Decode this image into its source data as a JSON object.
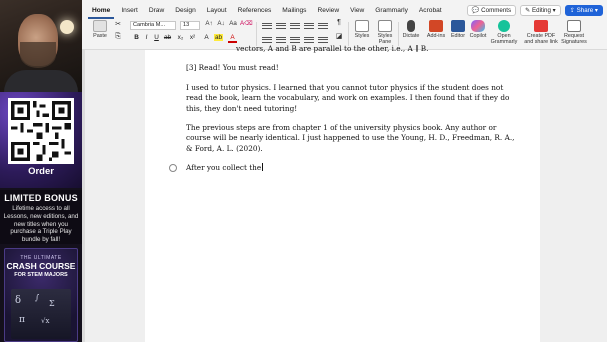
{
  "promo": {
    "order_label": "Order",
    "bonus_title": "LIMITED BONUS",
    "bonus_text": "Lifetime access to all Lessons, new editions, and new titles when you purchase a Triple Play bundle by fall!",
    "book_top": "THE ULTIMATE",
    "book_title": "CRASH COURSE",
    "book_sub": "FOR STEM MAJORS"
  },
  "ribbon": {
    "tabs": [
      "Home",
      "Insert",
      "Draw",
      "Design",
      "Layout",
      "References",
      "Mailings",
      "Review",
      "View",
      "Grammarly",
      "Acrobat"
    ],
    "active_tab": "Home",
    "comments": "Comments",
    "editing": "Editing",
    "share": "Share",
    "font_name": "Cambria M...",
    "font_size": "13",
    "paste": "Paste",
    "styles": "Styles",
    "styles_pane": "Styles Pane",
    "dictate": "Dictate",
    "addins": "Add-ins",
    "editor": "Editor",
    "copilot": "Copilot",
    "grammarly": "Open Grammarly",
    "create_pdf": "Create PDF and share link",
    "request_sig": "Request Signatures",
    "bold": "B",
    "italic": "I",
    "underline": "U",
    "strike": "ab",
    "subscript": "x₂",
    "superscript": "x²"
  },
  "document": {
    "top_line": "vectors, A and B are parallel to the other, i.e., A ∥ B.",
    "heading": "[3] Read! You must read!",
    "para1": "I used to tutor physics. I learned that you cannot tutor physics if the student does not read the book, learn the vocabulary, and work on examples. I then found that if they do this, they don't need tutoring!",
    "para2": "The previous steps are from chapter 1 of the university physics book. Any author or course will be nearly identical. I just happened to use the Young, H. D., Freedman, R. A., & Ford, A. L. (2020).",
    "typing": "After you collect the"
  },
  "colors": {
    "accent": "#2b579a",
    "share_blue": "#1f63d8",
    "grammarly_green": "#15c39a",
    "copilot": "#7b61ff"
  }
}
